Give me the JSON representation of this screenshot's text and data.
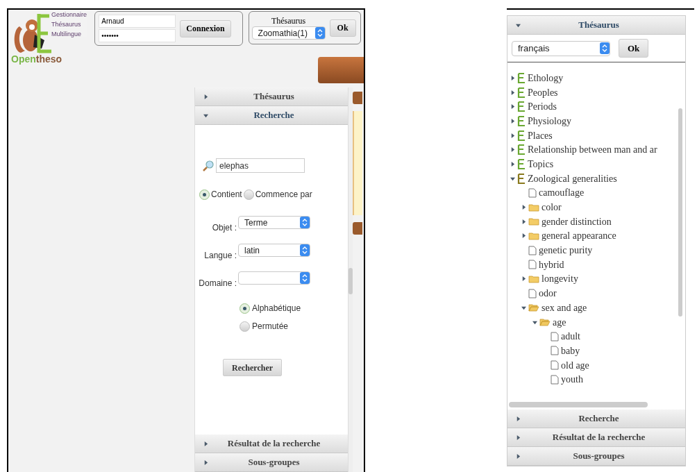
{
  "left_screen": {
    "logo": {
      "name_part1": "Open",
      "name_part2": "theso",
      "tags": [
        "Gestionnaire",
        "Thésaurus",
        "Multilingue"
      ]
    },
    "login": {
      "username": "Arnaud",
      "password": "•••••••",
      "button": "Connexion"
    },
    "thesaurus_picker": {
      "label": "Thésaurus",
      "value": "Zoomathia(1)",
      "button": "Ok"
    },
    "accordion": [
      {
        "label": "Thésaurus",
        "expanded": false
      },
      {
        "label": "Recherche",
        "expanded": true
      }
    ],
    "search": {
      "value": "elephas",
      "match_modes": [
        {
          "label": "Contient",
          "selected": true
        },
        {
          "label": "Commence par",
          "selected": false
        }
      ],
      "fields": [
        {
          "label": "Objet :",
          "value": "Terme"
        },
        {
          "label": "Langue :",
          "value": "latin"
        },
        {
          "label": "Domaine :"
        }
      ],
      "orders": [
        {
          "label": "Alphabétique",
          "selected": true
        },
        {
          "label": "Permutée",
          "selected": false
        }
      ],
      "button": "Rechercher"
    },
    "accordion_bottom": [
      {
        "label": "Résultat de la recherche",
        "expanded": false
      },
      {
        "label": "Sous-groupes",
        "expanded": false
      }
    ]
  },
  "right_screen": {
    "accordion_top": [
      {
        "label": "Thésaurus",
        "expanded": true
      }
    ],
    "language": {
      "value": "français",
      "button": "Ok"
    },
    "tree": [
      {
        "label": "Ethology",
        "kind": "group",
        "expanded": false
      },
      {
        "label": "Peoples",
        "kind": "group",
        "expanded": false
      },
      {
        "label": "Periods",
        "kind": "group",
        "expanded": false
      },
      {
        "label": "Physiology",
        "kind": "group",
        "expanded": false
      },
      {
        "label": "Places",
        "kind": "group",
        "expanded": false
      },
      {
        "label": "Relationship between man and ar",
        "kind": "group",
        "expanded": false
      },
      {
        "label": "Topics",
        "kind": "group",
        "expanded": false
      },
      {
        "label": "Zoological generalities",
        "kind": "group",
        "expanded": true,
        "children": [
          {
            "label": "camouflage",
            "kind": "leaf"
          },
          {
            "label": "color",
            "kind": "folder",
            "expanded": false
          },
          {
            "label": "gender distinction",
            "kind": "folder",
            "expanded": false
          },
          {
            "label": "general appearance",
            "kind": "folder",
            "expanded": false
          },
          {
            "label": "genetic purity",
            "kind": "leaf"
          },
          {
            "label": "hybrid",
            "kind": "leaf"
          },
          {
            "label": "longevity",
            "kind": "folder",
            "expanded": false
          },
          {
            "label": "odor",
            "kind": "leaf"
          },
          {
            "label": "sex and age",
            "kind": "folder",
            "expanded": true,
            "children": [
              {
                "label": "age",
                "kind": "folder",
                "expanded": true,
                "children": [
                  {
                    "label": "adult",
                    "kind": "leaf"
                  },
                  {
                    "label": "baby",
                    "kind": "leaf"
                  },
                  {
                    "label": "old age",
                    "kind": "leaf"
                  },
                  {
                    "label": "youth",
                    "kind": "leaf"
                  }
                ]
              }
            ]
          }
        ]
      }
    ],
    "accordion_bottom": [
      {
        "label": "Recherche",
        "expanded": false
      },
      {
        "label": "Résultat de la recherche",
        "expanded": false
      },
      {
        "label": "Sous-groupes",
        "expanded": false
      }
    ]
  }
}
